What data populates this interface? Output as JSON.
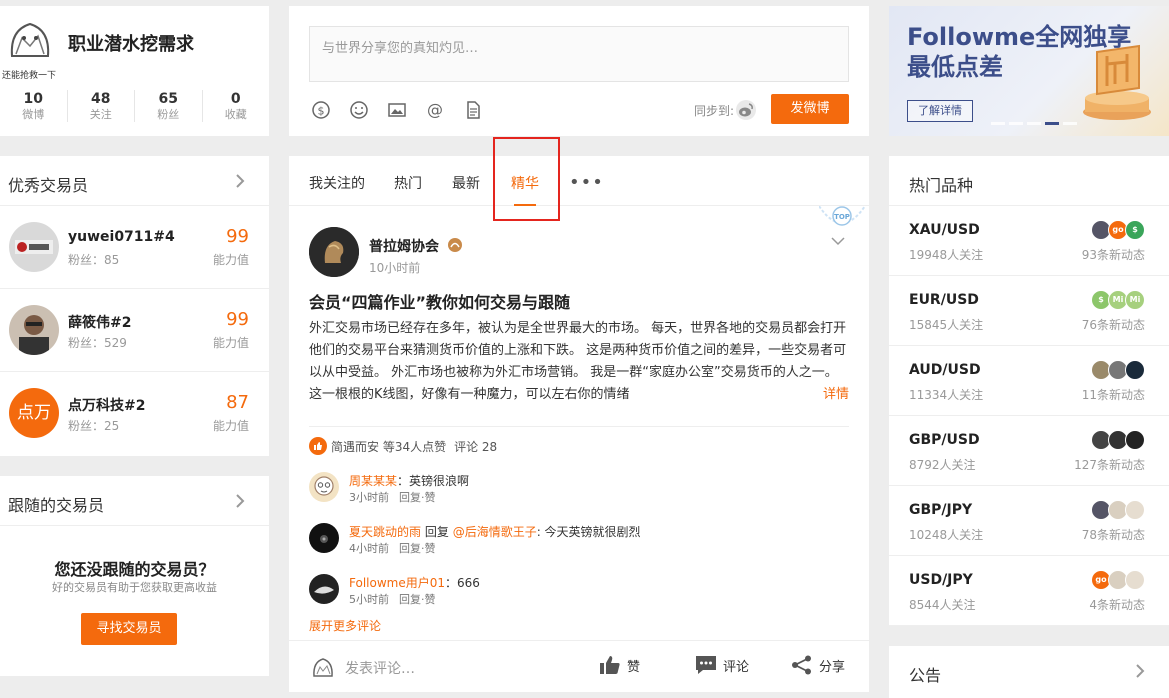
{
  "profile": {
    "avatar_caption": "还能抢救一下",
    "name": "职业潜水挖需求",
    "stats": [
      {
        "num": "10",
        "label": "微博"
      },
      {
        "num": "48",
        "label": "关注"
      },
      {
        "num": "65",
        "label": "粉丝"
      },
      {
        "num": "0",
        "label": "收藏"
      }
    ]
  },
  "traders": {
    "title": "优秀交易员",
    "items": [
      {
        "name": "yuwei0711#4",
        "fans": "粉丝：85",
        "score": "99",
        "score_label": "能力值"
      },
      {
        "name": "薛筱伟#2",
        "fans": "粉丝：529",
        "score": "99",
        "score_label": "能力值"
      },
      {
        "name": "点万科技#2",
        "fans": "粉丝：25",
        "score": "87",
        "score_label": "能力值",
        "avatar_text": "点万"
      }
    ]
  },
  "following": {
    "title": "跟随的交易员",
    "empty_title": "您还没跟随的交易员？",
    "empty_sub": "好的交易员有助于您获取更高收益",
    "button": "寻找交易员"
  },
  "composer": {
    "placeholder": "与世界分享您的真知灼见…",
    "sync_label": "同步到:",
    "post_button": "发微博"
  },
  "feed": {
    "tabs": [
      "我关注的",
      "热门",
      "最新",
      "精华"
    ],
    "active_tab": "精华",
    "more": "•••",
    "post": {
      "author": "普拉姆协会",
      "time": "10小时前",
      "badge": "TOP",
      "title": "会员“四篇作业”教你如何交易与跟随",
      "body": "外汇交易市场已经存在多年，被认为是全世界最大的市场。 每天，世界各地的交易员都会打开他们的交易平台来猜测货币价值的上涨和下跌。 这是两种货币价值之间的差异，一些交易者可以从中受益。 外汇市场也被称为外汇市场营销。  我是一群“家庭办公室”交易货币的人之一。这一根根的K线图，好像有一种魔力，可以左右你的情绪",
      "detail": "详情",
      "likes": "简遇而安 等34人点赞",
      "comment_count": "评论 28",
      "comments": [
        {
          "user": "周某某某",
          "text": "：英镑很浪啊",
          "time": "3小时前",
          "actions": "回复·赞"
        },
        {
          "user": "夏天跳动的雨",
          "reply_word": "回复",
          "reply_to": "@后海情歌王子",
          "text": ": 今天英镑就很剧烈",
          "time": "4小时前",
          "actions": "回复·赞"
        },
        {
          "user": "Followme用户01",
          "text": "：666",
          "time": "5小时前",
          "actions": "回复·赞"
        }
      ],
      "expand": "展开更多评论",
      "write_comment": "发表评论…",
      "like_label": "赞",
      "comment_label": "评论",
      "share_label": "分享"
    }
  },
  "banner": {
    "line1": "Followme全网独享",
    "line2": "最低点差",
    "button": "了解详情"
  },
  "hot": {
    "title": "热门品种",
    "items": [
      {
        "symbol": "XAU/USD",
        "followers": "19948人关注",
        "dynamics": "93条新动态"
      },
      {
        "symbol": "EUR/USD",
        "followers": "15845人关注",
        "dynamics": "76条新动态"
      },
      {
        "symbol": "AUD/USD",
        "followers": "11334人关注",
        "dynamics": "11条新动态"
      },
      {
        "symbol": "GBP/USD",
        "followers": "8792人关注",
        "dynamics": "127条新动态"
      },
      {
        "symbol": "GBP/JPY",
        "followers": "10248人关注",
        "dynamics": "78条新动态"
      },
      {
        "symbol": "USD/JPY",
        "followers": "8544人关注",
        "dynamics": "4条新动态"
      }
    ]
  },
  "notice": {
    "title": "公告"
  },
  "colors": {
    "accent": "#f46a0d",
    "highlight": "#e4251e",
    "banner_text": "#3c4e8a"
  }
}
